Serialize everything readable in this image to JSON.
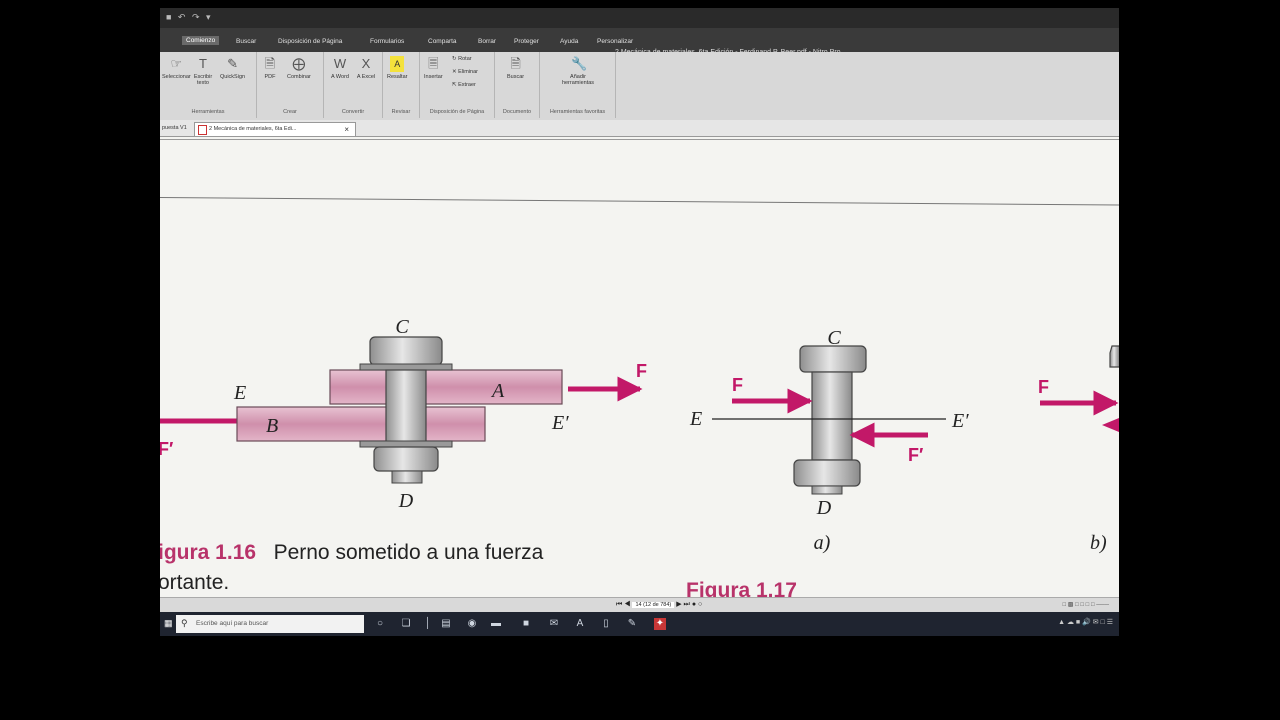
{
  "window": {
    "title": "2 Mecánica de materiales, 6ta Edición - Ferdinand P. Beer.pdf - Nitro Pro"
  },
  "ribbon_tabs": [
    "Comienzo",
    "Buscar",
    "Disposición de Página",
    "Formularios",
    "Comparta",
    "Borrar",
    "Proteger",
    "Ayuda",
    "Personalizar"
  ],
  "ribbon": {
    "groups": [
      {
        "label": "Herramientas",
        "buttons": [
          "Seleccionar",
          "Escribir texto",
          "QuickSign"
        ]
      },
      {
        "label": "Crear",
        "buttons": [
          "PDF",
          "Combinar"
        ]
      },
      {
        "label": "Convertir",
        "buttons": [
          "A Word",
          "A Excel"
        ]
      },
      {
        "label": "Revisar",
        "buttons": [
          "Resaltar"
        ]
      },
      {
        "label": "Disposición de Página",
        "buttons": [
          "Insertar",
          "Rotar",
          "Eliminar",
          "Extraer"
        ]
      },
      {
        "label": "Documento",
        "buttons": [
          "Buscar"
        ]
      },
      {
        "label": "Herramientas favoritas",
        "buttons": [
          "Añadir herramientas"
        ]
      }
    ]
  },
  "doc_tabs": {
    "left_partial": "puesta V1",
    "active": "2 Mecánica de materiales, 6ta Edi..."
  },
  "figure116": {
    "labels": {
      "c": "C",
      "e": "E",
      "a": "A",
      "b": "B",
      "e_prime": "E′",
      "f": "F",
      "f_prime": "F′",
      "d": "D"
    },
    "caption_num": "igura 1.16",
    "caption_text1": "Perno sometido a una fuerza",
    "caption_text2": "ortante."
  },
  "figure117": {
    "labels": {
      "c": "C",
      "f": "F",
      "e": "E",
      "e_prime": "E′",
      "f_prime": "F′",
      "d": "D",
      "sub_a": "a)",
      "sub_b": "b)"
    },
    "caption_num": "Fiqura 1.17"
  },
  "statusbar": {
    "page_display": "14 (12 de 784)"
  },
  "taskbar": {
    "search_placeholder": "Escribe aquí para buscar"
  },
  "colors": {
    "accent": "#c21868",
    "plate": "#d9a0b8",
    "bolt": "#bdbdbd"
  }
}
